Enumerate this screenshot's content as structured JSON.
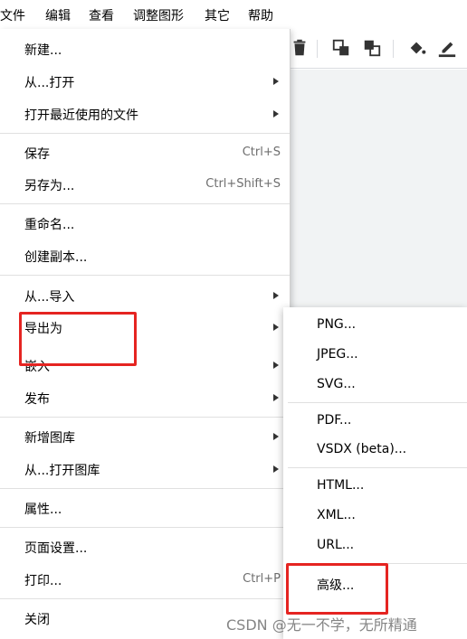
{
  "menubar": {
    "items": [
      "文件",
      "编辑",
      "查看",
      "调整图形",
      "其它",
      "帮助"
    ]
  },
  "file_menu": {
    "items": [
      {
        "label": "新建...",
        "shortcut": "",
        "submenu": false
      },
      {
        "label": "从...打开",
        "shortcut": "",
        "submenu": true
      },
      {
        "label": "打开最近使用的文件",
        "shortcut": "",
        "submenu": true
      },
      {
        "label": "保存",
        "shortcut": "Ctrl+S",
        "submenu": false
      },
      {
        "label": "另存为...",
        "shortcut": "Ctrl+Shift+S",
        "submenu": false
      },
      {
        "label": "重命名...",
        "shortcut": "",
        "submenu": false
      },
      {
        "label": "创建副本...",
        "shortcut": "",
        "submenu": false
      },
      {
        "label": "从...导入",
        "shortcut": "",
        "submenu": true
      },
      {
        "label": "导出为",
        "shortcut": "",
        "submenu": true
      },
      {
        "label": "嵌入",
        "shortcut": "",
        "submenu": true
      },
      {
        "label": "发布",
        "shortcut": "",
        "submenu": true
      },
      {
        "label": "新增图库",
        "shortcut": "",
        "submenu": true
      },
      {
        "label": "从...打开图库",
        "shortcut": "",
        "submenu": true
      },
      {
        "label": "属性...",
        "shortcut": "",
        "submenu": false
      },
      {
        "label": "页面设置...",
        "shortcut": "",
        "submenu": false
      },
      {
        "label": "打印...",
        "shortcut": "Ctrl+P",
        "submenu": false
      },
      {
        "label": "关闭",
        "shortcut": "",
        "submenu": false
      }
    ]
  },
  "export_submenu": {
    "items": [
      "PNG...",
      "JPEG...",
      "SVG...",
      "PDF...",
      "VSDX (beta)...",
      "HTML...",
      "XML...",
      "URL...",
      "高级..."
    ]
  },
  "toolbar": {
    "icons": [
      "delete-icon",
      "to-front-icon",
      "to-back-icon",
      "fill-color-icon",
      "line-color-icon"
    ]
  },
  "annotations": {
    "highlight_color": "#e52421"
  },
  "watermark": "CSDN @无一不学，无所精通"
}
